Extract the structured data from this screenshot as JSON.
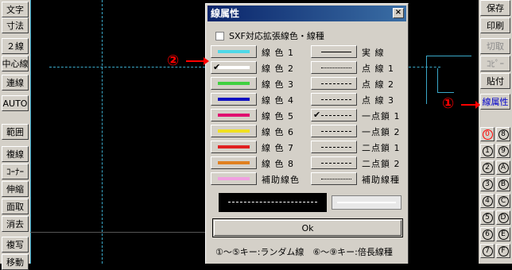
{
  "left_toolbar": [
    "文字",
    "寸法",
    "２線",
    "中心線",
    "連線",
    "AUTO",
    "範囲",
    "複線",
    "ｺｰﾅｰ",
    "伸縮",
    "面取",
    "消去",
    "複写",
    "移動"
  ],
  "right_toolbar": [
    "保存",
    "印刷",
    "切取",
    "ｺﾋﾟｰ",
    "貼付",
    "線属性"
  ],
  "right_numbers": [
    [
      "0",
      "8"
    ],
    [
      "1",
      "9"
    ],
    [
      "2",
      "A"
    ],
    [
      "3",
      "B"
    ],
    [
      "4",
      "C"
    ],
    [
      "5",
      "D"
    ],
    [
      "6",
      "E"
    ],
    [
      "7",
      "F"
    ]
  ],
  "dialog": {
    "title": "線属性",
    "close_label": "×",
    "sxf_label": "SXF対応拡張線色・線種",
    "colors": [
      {
        "label": "線 色 1",
        "color": "#4fd8e8",
        "checked": false
      },
      {
        "label": "線 色 2",
        "color": "#ffffff",
        "checked": true
      },
      {
        "label": "線 色 3",
        "color": "#40d040",
        "checked": false
      },
      {
        "label": "線 色 4",
        "color": "#1010c0",
        "checked": false
      },
      {
        "label": "線 色 5",
        "color": "#e01070",
        "checked": false
      },
      {
        "label": "線 色 6",
        "color": "#f0e020",
        "checked": false
      },
      {
        "label": "線 色 7",
        "color": "#e02020",
        "checked": false
      },
      {
        "label": "線 色 8",
        "color": "#e08020",
        "checked": false
      },
      {
        "label": "補助線色",
        "color": "#f0a0e0",
        "checked": false
      }
    ],
    "linetypes": [
      {
        "label": "実 線",
        "style": "solid",
        "checked": false
      },
      {
        "label": "点 線 1",
        "style": "dotted",
        "checked": false
      },
      {
        "label": "点 線 2",
        "style": "dashed",
        "checked": false
      },
      {
        "label": "点 線 3",
        "style": "dashed",
        "checked": false
      },
      {
        "label": "一点鎖 1",
        "style": "dashed",
        "checked": true
      },
      {
        "label": "一点鎖 2",
        "style": "dashed",
        "checked": false
      },
      {
        "label": "二点鎖 1",
        "style": "dashed",
        "checked": false
      },
      {
        "label": "二点鎖 2",
        "style": "dashed",
        "checked": false
      },
      {
        "label": "補助線種",
        "style": "dotted",
        "checked": false
      }
    ],
    "ok_label": "Ok",
    "footer": "①～⑤キー:ランダム線　⑥～⑨キー:倍長線種"
  },
  "callouts": {
    "one": "①",
    "two": "②"
  }
}
